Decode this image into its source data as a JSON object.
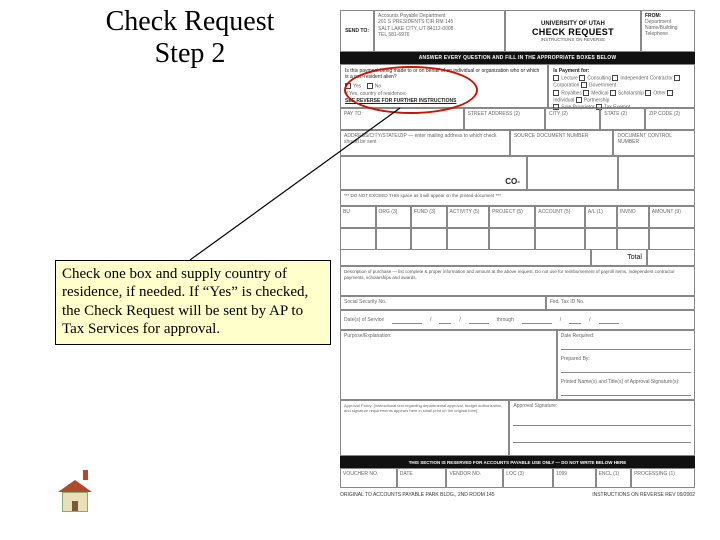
{
  "title": {
    "line1": "Check Request",
    "line2": "Step  2"
  },
  "note": "Check one box and supply country of residence, if needed. If “Yes” is checked, the Check Request will be sent by AP to Tax Services for approval.",
  "form": {
    "sendto": {
      "label": "SEND TO:",
      "line1": "Accounts Payable Department",
      "line2": "201 S PRESIDENTS CIR RM 145",
      "line3": "SALT LAKE CITY, UT 84112-0008",
      "line4": "TEL 581-6976"
    },
    "center": {
      "org": "UNIVERSITY OF UTAH",
      "title": "CHECK REQUEST",
      "sub": "INSTRUCTIONS ON REVERSE"
    },
    "from": {
      "label": "FROM:",
      "l1": "Department",
      "l2": "Name/Building",
      "l3": "Telephone"
    },
    "blackbar": "ANSWER EVERY QUESTION AND FILL IN THE APPROPRIATE BOXES BELOW",
    "q1": {
      "text": "Is this payment being made to or on behalf of an individual or organization who or which is a non-resident alien?",
      "yes": "Yes",
      "no": "No",
      "sub": "If Yes, country of residence:",
      "see": "SEE REVERSE FOR FURTHER INSTRUCTIONS"
    },
    "payfor": {
      "label": "Is Payment for:",
      "opts": [
        "Lecture",
        "Consulting",
        "Independent Contractor",
        "Corporation",
        "Government",
        "Royalties",
        "Medical",
        "Scholarship",
        "Other",
        "Individual",
        "Partnership",
        "Sole Proprietor",
        "Tax Exempt"
      ]
    },
    "payto": {
      "a": "PAY TO:",
      "b": "STREET ADDRESS (2)",
      "c": "CITY (2)",
      "d": "STATE (2)",
      "e": "ZIP CODE (2)"
    },
    "addr": {
      "a": "ADDRESS/CITY/STATE/ZIP — enter mailing address to which check should be sent",
      "b": "SOURCE DOCUMENT NUMBER",
      "c": "DOCUMENT CONTROL NUMBER"
    },
    "co": "CO-",
    "coline": "*** DO NOT EXCEED THIS space as it will appear on the printed document ***",
    "codes": {
      "c1": "BU",
      "c2": "ORG (3)",
      "c3": "FUND (3)",
      "c4": "ACTIVITY (5)",
      "c5": "PROJECT (5)",
      "c6": "ACCOUNT (5)",
      "c7": "A/L (1)",
      "c8": "INVNO",
      "c9": "AMOUNT (9)"
    },
    "total": "Total",
    "desc": "Description of purchase — list complete & proper information and amount at the above request. Do not use for reimbursement of payroll items, independent contractor payments, scholarships and awards.",
    "ssn": {
      "a": "Social Security No.",
      "b": "Fed. Tax ID No."
    },
    "svc": {
      "label": "Date(s) of Service",
      "thru": "through"
    },
    "purpose": {
      "label": "Purpose/Explanation:",
      "dr": "Date Required:",
      "pb": "Prepared By:",
      "pn": "Printed Name(s) and Title(s) of Approval Signature(s):"
    },
    "approval": {
      "policy": "Approval Policy: [instructional text regarding departmental approval, budget authorization, and signature requirements appears here in small print on the original form]",
      "sig": "Approval Signature:"
    },
    "blackbar2": "THIS SECTION IS RESERVED FOR ACCOUNTS PAYABLE USE ONLY — DO NOT WRITE BELOW HERE",
    "aponly": {
      "c1": "VOUCHER NO.",
      "c2": "DATE",
      "c3": "VENDOR NO.",
      "c4": "LOC (3)",
      "c5": "1099",
      "c6": "ENCL (1)",
      "c7": "PROCESSING (1)"
    },
    "footer": {
      "left": "ORIGINAL TO ACCOUNTS PAYABLE  PARK BLDG., 2ND ROOM 145",
      "right": "INSTRUCTIONS ON REVERSE  REV 09/2002"
    }
  },
  "icon": {
    "name": "home-icon"
  }
}
